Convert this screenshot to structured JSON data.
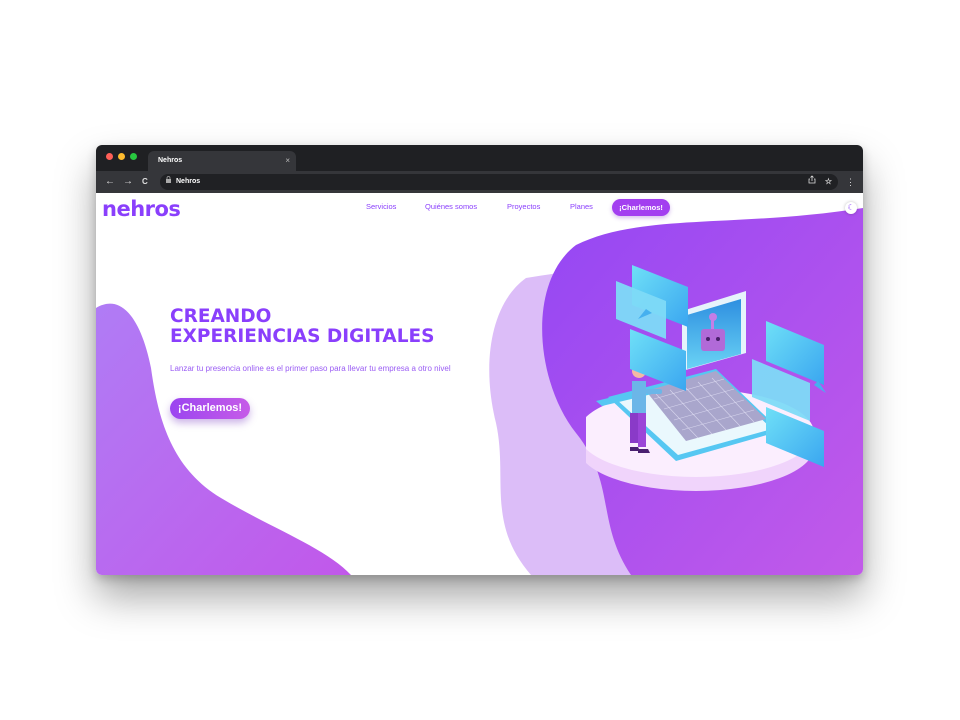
{
  "browser": {
    "tab_title": "Nehros",
    "tab_close": "×",
    "url": "Nehros",
    "back": "←",
    "forward": "→",
    "reload": "C",
    "share_icon": "share-icon",
    "star_icon": "star-icon",
    "menu": "⋮",
    "dot_colors": [
      "#ff5f57",
      "#febc2e",
      "#28c840"
    ]
  },
  "site": {
    "logo": "nehros",
    "nav": [
      "Servicios",
      "Quiénes somos",
      "Proyectos",
      "Planes"
    ],
    "nav_cta": "¡Charlemos!",
    "theme_icon": "moon-icon",
    "accent": "#8a3ffc"
  },
  "hero": {
    "title_line1": "CREANDO",
    "title_line2": "EXPERIENCIAS DIGITALES",
    "subtitle": "Lanzar tu presencia online es el primer paso para llevar tu empresa a otro nivel",
    "cta": "¡Charlemos!"
  }
}
